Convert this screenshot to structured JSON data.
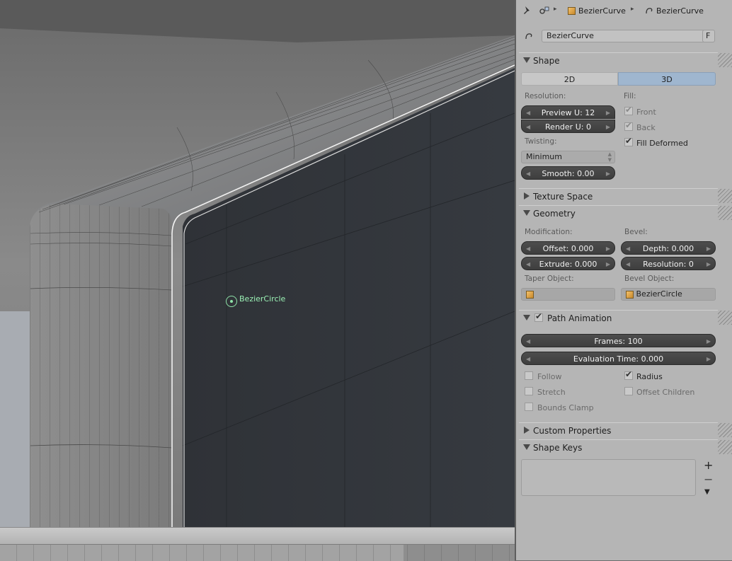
{
  "header": {
    "breadcrumb_object": "BezierCurve",
    "breadcrumb_data": "BezierCurve",
    "datablock_name": "BezierCurve",
    "fake_user": "F"
  },
  "viewport": {
    "object_label": "BezierCircle"
  },
  "shape": {
    "title": "Shape",
    "dim_2d": "2D",
    "dim_3d": "3D",
    "resolution_label": "Resolution:",
    "preview_u": "Preview U: 12",
    "render_u": "Render U: 0",
    "fill_label": "Fill:",
    "fill_front": "Front",
    "fill_back": "Back",
    "fill_deformed": "Fill Deformed",
    "twisting_label": "Twisting:",
    "twisting_value": "Minimum",
    "smooth": "Smooth: 0.00"
  },
  "texture_space": {
    "title": "Texture Space"
  },
  "geometry": {
    "title": "Geometry",
    "modification_label": "Modification:",
    "bevel_label": "Bevel:",
    "offset": "Offset: 0.000",
    "depth": "Depth: 0.000",
    "extrude": "Extrude: 0.000",
    "resolution": "Resolution: 0",
    "taper_label": "Taper Object:",
    "bevel_object_label": "Bevel Object:",
    "bevel_object_value": "BezierCircle"
  },
  "path_animation": {
    "title": "Path Animation",
    "frames": "Frames: 100",
    "evaluation_time": "Evaluation Time: 0.000",
    "follow": "Follow",
    "radius": "Radius",
    "stretch": "Stretch",
    "offset_children": "Offset Children",
    "bounds_clamp": "Bounds Clamp"
  },
  "custom_properties": {
    "title": "Custom Properties"
  },
  "shape_keys": {
    "title": "Shape Keys",
    "add": "+",
    "remove": "−",
    "menu": "▼"
  }
}
